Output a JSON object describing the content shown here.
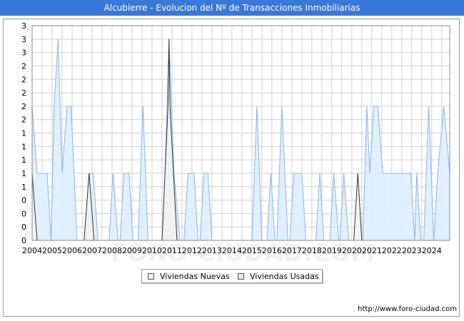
{
  "title": "Alcubierre - Evolucion del Nº de Transacciones Inmobiliarias",
  "source_url": "http://www.foro-ciudad.com",
  "watermark": "FORO-CIUDAD.COM",
  "colors": {
    "title_bg": "#3a78d8",
    "nuevas_fill": "#f2f2f2",
    "nuevas_line": "#333333",
    "usadas_fill": "#ddeeff",
    "usadas_line": "#8fb3e6",
    "grid": "#d0d0d0"
  },
  "legend": {
    "nuevas_label": "Viviendas Nuevas",
    "usadas_label": "Viviendas Usadas"
  },
  "chart_data": {
    "type": "area",
    "title": "Alcubierre - Evolucion del Nº de Transacciones Inmobiliarias",
    "xlabel": "",
    "ylabel": "",
    "ylim": [
      0,
      3.2
    ],
    "yticks": [
      0,
      0.2,
      0.4,
      0.6,
      0.8,
      1.0,
      1.2,
      1.4,
      1.6,
      1.8,
      2.0,
      2.2,
      2.4,
      2.6,
      2.8,
      3.0,
      3.2
    ],
    "ytick_labels": [
      "0",
      "0",
      "0",
      "0",
      "1",
      "1",
      "1",
      "1",
      "1",
      "2",
      "2",
      "2",
      "2",
      "2",
      "3",
      "3",
      "3"
    ],
    "xlim": [
      2004.0,
      2024.9
    ],
    "xtick_labels": [
      "2004",
      "2005",
      "2006",
      "2007",
      "2008",
      "2009",
      "2010",
      "2011",
      "2012",
      "2013",
      "2014",
      "2015",
      "2016",
      "2017",
      "2018",
      "2019",
      "2020",
      "2021",
      "2022",
      "2023",
      "2024"
    ],
    "grid": true,
    "legend_position": "bottom",
    "series": [
      {
        "name": "Viviendas Nuevas",
        "points": [
          [
            2004.0,
            1
          ],
          [
            2004.25,
            0
          ],
          [
            2006.6,
            0
          ],
          [
            2006.85,
            1
          ],
          [
            2007.1,
            0
          ],
          [
            2010.5,
            0
          ],
          [
            2010.8,
            2
          ],
          [
            2010.85,
            3
          ],
          [
            2010.9,
            2
          ],
          [
            2011.25,
            0
          ],
          [
            2020.1,
            0
          ],
          [
            2020.3,
            1
          ],
          [
            2020.5,
            0
          ]
        ]
      },
      {
        "name": "Viviendas Usadas",
        "points": [
          [
            2004.0,
            2
          ],
          [
            2004.25,
            1
          ],
          [
            2004.75,
            1
          ],
          [
            2004.95,
            0
          ],
          [
            2005.1,
            2
          ],
          [
            2005.3,
            3
          ],
          [
            2005.5,
            1
          ],
          [
            2005.75,
            2
          ],
          [
            2005.95,
            2
          ],
          [
            2006.25,
            0
          ],
          [
            2006.65,
            0
          ],
          [
            2006.85,
            1
          ],
          [
            2007.05,
            1
          ],
          [
            2007.3,
            0
          ],
          [
            2007.85,
            0
          ],
          [
            2008.05,
            1
          ],
          [
            2008.3,
            0
          ],
          [
            2008.4,
            0
          ],
          [
            2008.6,
            1
          ],
          [
            2008.85,
            1
          ],
          [
            2009.05,
            0
          ],
          [
            2009.3,
            0
          ],
          [
            2009.55,
            2
          ],
          [
            2009.8,
            0
          ],
          [
            2010.55,
            0
          ],
          [
            2010.85,
            3
          ],
          [
            2011.1,
            1
          ],
          [
            2011.4,
            0
          ],
          [
            2011.6,
            0
          ],
          [
            2011.8,
            1
          ],
          [
            2012.1,
            1
          ],
          [
            2012.3,
            0
          ],
          [
            2012.4,
            0
          ],
          [
            2012.6,
            1
          ],
          [
            2012.8,
            1
          ],
          [
            2013.0,
            0
          ],
          [
            2015.0,
            0
          ],
          [
            2015.25,
            2
          ],
          [
            2015.5,
            0
          ],
          [
            2015.75,
            0
          ],
          [
            2015.95,
            1
          ],
          [
            2016.15,
            0
          ],
          [
            2016.25,
            0
          ],
          [
            2016.5,
            2
          ],
          [
            2016.8,
            0
          ],
          [
            2016.9,
            0
          ],
          [
            2017.1,
            1
          ],
          [
            2017.5,
            1
          ],
          [
            2017.7,
            0
          ],
          [
            2018.2,
            0
          ],
          [
            2018.4,
            1
          ],
          [
            2018.6,
            0
          ],
          [
            2018.9,
            0
          ],
          [
            2019.1,
            1
          ],
          [
            2019.35,
            0
          ],
          [
            2019.4,
            0
          ],
          [
            2019.6,
            1
          ],
          [
            2019.85,
            0
          ],
          [
            2020.55,
            0
          ],
          [
            2020.75,
            2
          ],
          [
            2020.9,
            1
          ],
          [
            2021.1,
            2
          ],
          [
            2021.3,
            2
          ],
          [
            2021.55,
            1
          ],
          [
            2022.95,
            1
          ],
          [
            2023.15,
            0
          ],
          [
            2023.25,
            1
          ],
          [
            2023.45,
            0
          ],
          [
            2023.6,
            0
          ],
          [
            2023.85,
            2
          ],
          [
            2024.1,
            0
          ],
          [
            2024.3,
            1
          ],
          [
            2024.6,
            2
          ],
          [
            2024.9,
            1
          ]
        ]
      }
    ]
  }
}
